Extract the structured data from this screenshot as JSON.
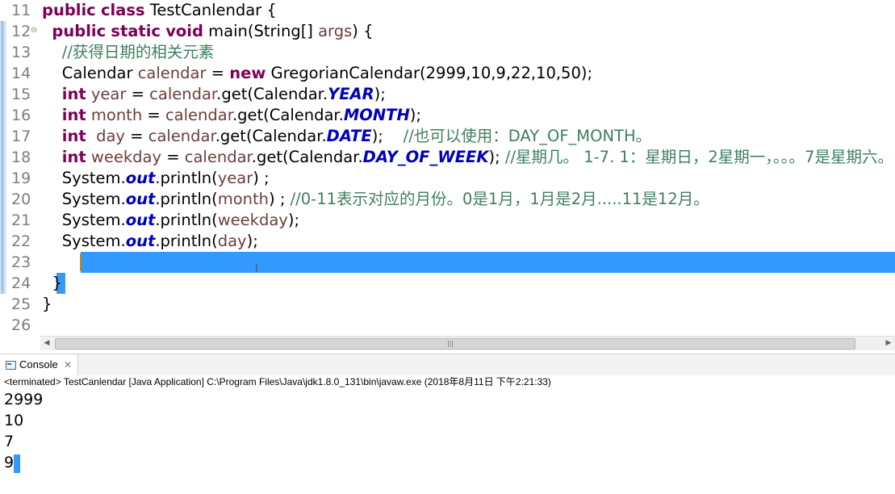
{
  "editor": {
    "lines": [
      {
        "num": "11",
        "segments": [
          {
            "t": "public",
            "c": "kw"
          },
          {
            "t": " "
          },
          {
            "t": "class",
            "c": "kw"
          },
          {
            "t": " TestCanlendar {"
          }
        ]
      },
      {
        "num": "12",
        "fold": true,
        "segments": [
          {
            "t": "  "
          },
          {
            "t": "public",
            "c": "kw"
          },
          {
            "t": " "
          },
          {
            "t": "static",
            "c": "kw"
          },
          {
            "t": " "
          },
          {
            "t": "void",
            "c": "kw"
          },
          {
            "t": " main(String[] "
          },
          {
            "t": "args",
            "c": "var"
          },
          {
            "t": ") {"
          }
        ]
      },
      {
        "num": "13",
        "segments": [
          {
            "t": "    "
          },
          {
            "t": "//获得日期的相关元素",
            "c": "cm"
          }
        ]
      },
      {
        "num": "14",
        "segments": [
          {
            "t": "    Calendar "
          },
          {
            "t": "calendar",
            "c": "var"
          },
          {
            "t": " = "
          },
          {
            "t": "new",
            "c": "kw"
          },
          {
            "t": " GregorianCalendar(2999,10,9,22,10,50);"
          }
        ]
      },
      {
        "num": "15",
        "segments": [
          {
            "t": "    "
          },
          {
            "t": "int",
            "c": "kw"
          },
          {
            "t": " "
          },
          {
            "t": "year",
            "c": "var"
          },
          {
            "t": " = "
          },
          {
            "t": "calendar",
            "c": "var"
          },
          {
            "t": ".get(Calendar."
          },
          {
            "t": "YEAR",
            "c": "fld"
          },
          {
            "t": ");"
          }
        ]
      },
      {
        "num": "16",
        "segments": [
          {
            "t": "    "
          },
          {
            "t": "int",
            "c": "kw"
          },
          {
            "t": " "
          },
          {
            "t": "month",
            "c": "var"
          },
          {
            "t": " = "
          },
          {
            "t": "calendar",
            "c": "var"
          },
          {
            "t": ".get(Calendar."
          },
          {
            "t": "MONTH",
            "c": "fld"
          },
          {
            "t": ");"
          }
        ]
      },
      {
        "num": "17",
        "segments": [
          {
            "t": "    "
          },
          {
            "t": "int",
            "c": "kw"
          },
          {
            "t": "  "
          },
          {
            "t": "day",
            "c": "var"
          },
          {
            "t": " = "
          },
          {
            "t": "calendar",
            "c": "var"
          },
          {
            "t": ".get(Calendar."
          },
          {
            "t": "DATE",
            "c": "fld"
          },
          {
            "t": ");    "
          },
          {
            "t": "//也可以使用：DAY_OF_MONTH。",
            "c": "cm"
          }
        ]
      },
      {
        "num": "18",
        "segments": [
          {
            "t": "    "
          },
          {
            "t": "int",
            "c": "kw"
          },
          {
            "t": " "
          },
          {
            "t": "weekday",
            "c": "var"
          },
          {
            "t": " = "
          },
          {
            "t": "calendar",
            "c": "var"
          },
          {
            "t": ".get(Calendar."
          },
          {
            "t": "DAY_OF_WEEK",
            "c": "fld"
          },
          {
            "t": "); "
          },
          {
            "t": "//星期几。 1-7. 1：星期日，2星期一，。。。7是星期六。",
            "c": "cm"
          }
        ]
      },
      {
        "num": "19",
        "segments": [
          {
            "t": "    System."
          },
          {
            "t": "out",
            "c": "fld"
          },
          {
            "t": ".println("
          },
          {
            "t": "year",
            "c": "var"
          },
          {
            "t": ") ;"
          }
        ]
      },
      {
        "num": "20",
        "segments": [
          {
            "t": "    System."
          },
          {
            "t": "out",
            "c": "fld"
          },
          {
            "t": ".println("
          },
          {
            "t": "month",
            "c": "var"
          },
          {
            "t": ") ; "
          },
          {
            "t": "//0-11表示对应的月份。0是1月，1月是2月.....11是12月。",
            "c": "cm"
          }
        ]
      },
      {
        "num": "21",
        "segments": [
          {
            "t": "    System."
          },
          {
            "t": "out",
            "c": "fld"
          },
          {
            "t": ".println("
          },
          {
            "t": "weekday",
            "c": "var"
          },
          {
            "t": ");"
          }
        ]
      },
      {
        "num": "22",
        "segments": [
          {
            "t": "    System."
          },
          {
            "t": "out",
            "c": "fld"
          },
          {
            "t": ".println("
          },
          {
            "t": "day",
            "c": "var"
          },
          {
            "t": ");"
          }
        ]
      },
      {
        "num": "23",
        "segments": []
      },
      {
        "num": "24",
        "segments": [
          {
            "t": "  }"
          }
        ]
      },
      {
        "num": "25",
        "segments": [
          {
            "t": "}"
          }
        ]
      },
      {
        "num": "26",
        "segments": []
      }
    ],
    "colors": {
      "keyword": "#7f0055",
      "comment": "#3f7f5f",
      "field": "#0000c0",
      "variable": "#6a3e3e",
      "selection": "#3399ff"
    }
  },
  "scrollbar": {
    "left_arrow": "◀",
    "right_arrow": "▶",
    "grip": "|||"
  },
  "console": {
    "tab_label": "Console",
    "close_glyph": "✕",
    "icon": "console-icon",
    "status": "<terminated> TestCanlendar [Java Application] C:\\Program Files\\Java\\jdk1.8.0_131\\bin\\javaw.exe (2018年8月11日 下午2:21:33)",
    "output": [
      "2999",
      "10",
      "7",
      "9"
    ]
  }
}
